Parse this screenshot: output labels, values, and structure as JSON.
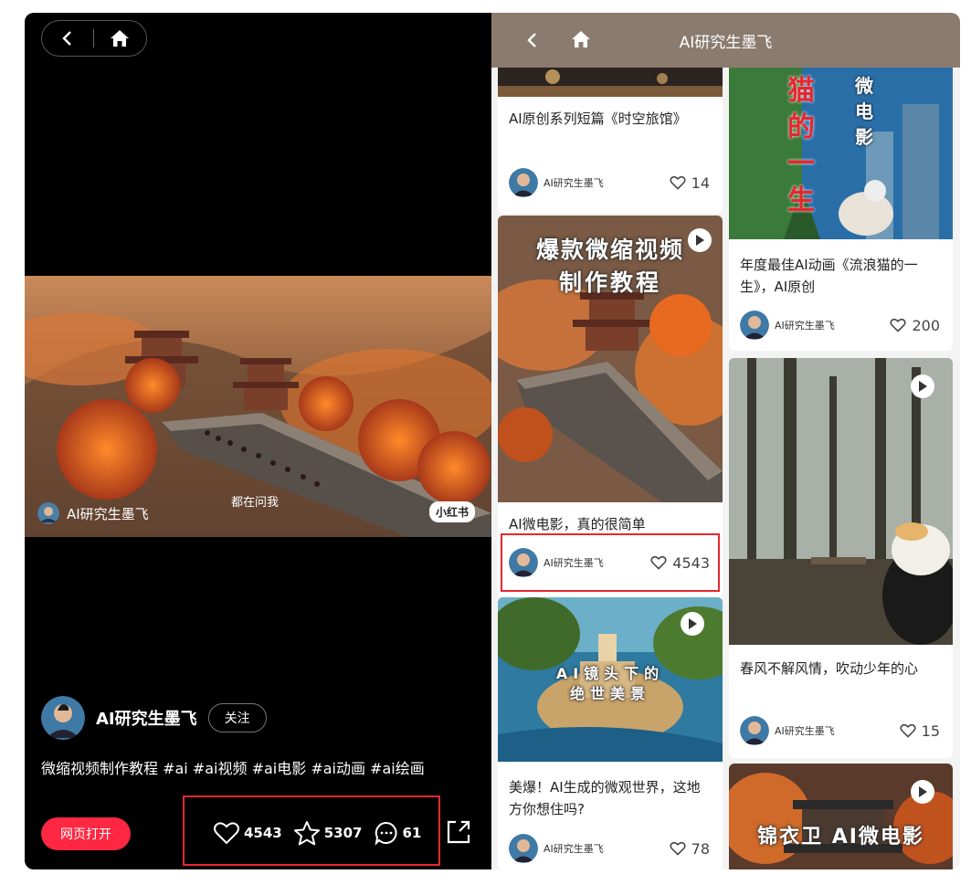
{
  "left": {
    "video_overlay_author": "AI研究生墨飞",
    "video_overlay_mid": "都在问我",
    "badge": "小红书",
    "author_name": "AI研究生墨飞",
    "follow": "关注",
    "description": "微缩视频制作教程 #ai #ai视频 #ai电影 #ai动画 #ai绘画",
    "open_button": "网页打开",
    "likes": "4543",
    "favorites": "5307",
    "comments": "61"
  },
  "right": {
    "title": "AI研究生墨飞",
    "cards": [
      {
        "title": "AI原创系列短篇《时空旅馆》",
        "author": "AI研究生墨飞",
        "likes": "14"
      },
      {
        "title": "AI微电影，真的很简单",
        "author": "AI研究生墨飞",
        "likes": "4543",
        "overlay_l1": "爆款微缩视频",
        "overlay_l2": "制作教程"
      },
      {
        "title": "美爆！AI生成的微观世界，这地方你想住吗?",
        "author": "AI研究生墨飞",
        "likes": "78",
        "overlay_l1": "AI镜头下的",
        "overlay_l2": "绝世美景"
      },
      {
        "title": "年度最佳AI动画《流浪猫的一生》，AI原创",
        "author": "AI研究生墨飞",
        "likes": "200",
        "overlay_l1": "猫的一生",
        "overlay_l2": "微电影"
      },
      {
        "title": "春风不解风情，吹动少年的心",
        "author": "AI研究生墨飞",
        "likes": "15"
      },
      {
        "title": "",
        "author": "",
        "likes": "",
        "overlay_l1": "锦衣卫 AI微电影"
      }
    ]
  },
  "colors": {
    "accent_red": "#ff2741",
    "highlight": "#e8272e",
    "header_bar": "#8b7b6f"
  },
  "icons": [
    "back-icon",
    "home-icon",
    "heart-icon",
    "star-icon",
    "comment-icon",
    "share-icon",
    "play-icon"
  ]
}
